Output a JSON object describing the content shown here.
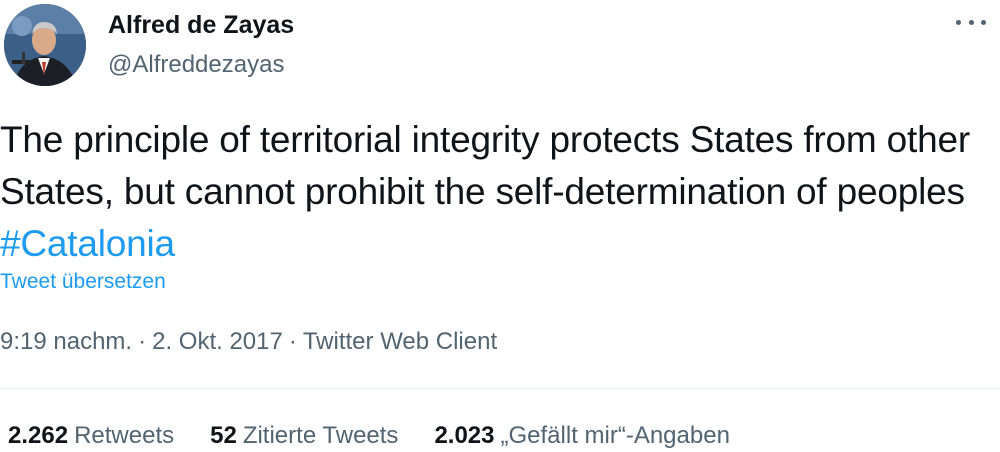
{
  "author": {
    "display_name": "Alfred de Zayas",
    "handle": "@Alfreddezayas"
  },
  "tweet": {
    "text_main": "The principle of territorial integrity protects States from other States, but cannot prohibit the self-determination of peoples ",
    "hashtag": "#Catalonia",
    "translate_label": "Tweet übersetzen"
  },
  "meta": {
    "time": "9:19 nachm.",
    "separator": "·",
    "date": "2. Okt. 2017",
    "client": "Twitter Web Client"
  },
  "stats": {
    "retweets_count": "2.262",
    "retweets_label": "Retweets",
    "quotes_count": "52",
    "quotes_label": "Zitierte Tweets",
    "likes_count": "2.023",
    "likes_label": "„Gefällt mir“-Angaben"
  },
  "colors": {
    "accent": "#1d9bf0",
    "text_primary": "#0f1419",
    "text_secondary": "#536471",
    "divider": "#e6ecf0"
  },
  "icons": {
    "more": "more-horizontal-icon"
  }
}
